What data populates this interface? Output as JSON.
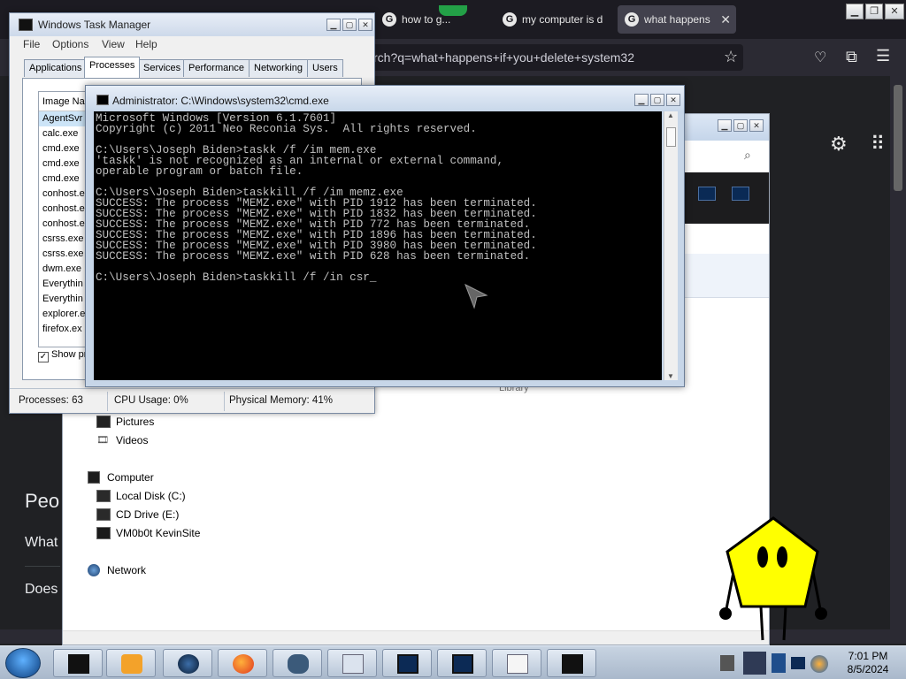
{
  "browser": {
    "tabs": [
      {
        "label": "how to g..."
      },
      {
        "label": "my computer is d"
      },
      {
        "label": "what happens"
      }
    ],
    "url": "rch?q=what+happens+if+you+delete+system32",
    "page_text": {
      "heading": "Peo",
      "item1": "What",
      "item2": "Does"
    }
  },
  "explorer": {
    "library_label": "Library",
    "items": [
      {
        "label": "Pictures",
        "icon": "pictures-icon"
      },
      {
        "label": "Videos",
        "icon": "videos-icon"
      },
      {
        "label": "Computer",
        "icon": "computer-icon"
      },
      {
        "label": "Local Disk (C:)",
        "icon": "disk-icon"
      },
      {
        "label": "CD Drive (E:)",
        "icon": "cd-drive-icon"
      },
      {
        "label": "VM0b0t KevinSite",
        "icon": "network-drive-icon"
      },
      {
        "label": "Network",
        "icon": "network-icon"
      }
    ]
  },
  "taskmgr": {
    "title": "Windows Task Manager",
    "menu": [
      "File",
      "Options",
      "View",
      "Help"
    ],
    "tabs": [
      "Applications",
      "Processes",
      "Services",
      "Performance",
      "Networking",
      "Users"
    ],
    "active_tab": "Processes",
    "column_header": "Image Na",
    "processes": [
      "AgentSvr",
      "calc.exe",
      "cmd.exe",
      "cmd.exe",
      "cmd.exe",
      "conhost.e",
      "conhost.e",
      "conhost.e",
      "csrss.exe",
      "csrss.exe",
      "dwm.exe",
      "Everythin",
      "Everythin",
      "explorer.e",
      "firefox.ex"
    ],
    "show_processes_label": "Show pr",
    "status": {
      "processes": "Processes: 63",
      "cpu": "CPU Usage: 0%",
      "memory": "Physical Memory: 41%"
    }
  },
  "cmd": {
    "title": "Administrator: C:\\Windows\\system32\\cmd.exe",
    "lines": [
      "Microsoft Windows [Version 6.1.7601]",
      "Copyright (c) 2011 Neo Reconia Sys.  All rights reserved.",
      "",
      "C:\\Users\\Joseph Biden>taskk /f /im mem.exe",
      "'taskk' is not recognized as an internal or external command,",
      "operable program or batch file.",
      "",
      "C:\\Users\\Joseph Biden>taskkill /f /im memz.exe",
      "SUCCESS: The process \"MEMZ.exe\" with PID 1912 has been terminated.",
      "SUCCESS: The process \"MEMZ.exe\" with PID 1832 has been terminated.",
      "SUCCESS: The process \"MEMZ.exe\" with PID 772 has been terminated.",
      "SUCCESS: The process \"MEMZ.exe\" with PID 1896 has been terminated.",
      "SUCCESS: The process \"MEMZ.exe\" with PID 3980 has been terminated.",
      "SUCCESS: The process \"MEMZ.exe\" with PID 628 has been terminated.",
      "",
      "C:\\Users\\Joseph Biden>taskkill /f /in csr_"
    ]
  },
  "taskbar": {
    "time": "7:01 PM",
    "date": "8/5/2024"
  },
  "colors": {
    "cmd_bg": "#000000",
    "cmd_fg": "#c0c0c0",
    "browser_bg": "#1c1b22",
    "character_yellow": "#ffff00"
  }
}
